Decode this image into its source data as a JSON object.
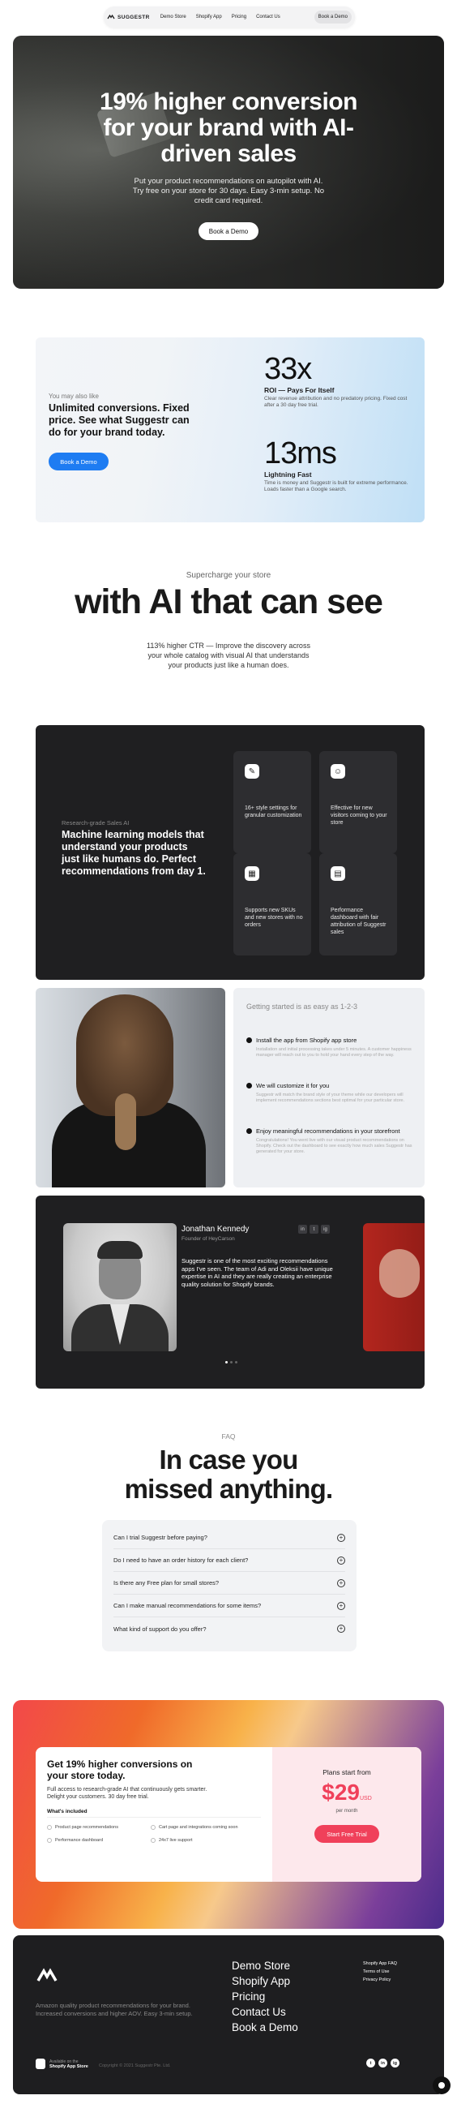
{
  "nav": {
    "logo_text": "SUGGESTR",
    "items": [
      "Demo Store",
      "Shopify App",
      "Pricing",
      "Contact Us"
    ],
    "demo_label": "Book a Demo"
  },
  "hero": {
    "title": "19% higher conversion for your brand with AI-driven sales",
    "subtitle": "Put your product recommendations on autopilot with AI. Try free on your store for 30 days. Easy 3-min setup. No credit card required.",
    "cta": "Book a Demo"
  },
  "promo": {
    "kicker": "You may also like",
    "title": "Unlimited conversions. Fixed price. See what Suggestr can do for your brand today.",
    "cta": "Book a Demo",
    "stats": [
      {
        "value": "33x",
        "title": "ROI — Pays For Itself",
        "desc": "Clear revenue attribution and no predatory pricing. Fixed cost after a 30 day free trial."
      },
      {
        "value": "13ms",
        "title": "Lightning Fast",
        "desc": "Time is money and Suggestr is built for extreme performance. Loads faster than a Google search."
      }
    ]
  },
  "supercharge": {
    "kicker": "Supercharge your store",
    "title": "with AI that can see",
    "desc": "113% higher CTR — Improve the discovery across your whole catalog with visual AI that understands your products just like a human does."
  },
  "ml": {
    "kicker": "Research-grade Sales AI",
    "title": "Machine learning models that understand your products just like humans do. Perfect recommendations from day 1.",
    "tiles": [
      {
        "icon": "pencil-icon",
        "glyph": "✎",
        "text": "16+ style settings for granular customization"
      },
      {
        "icon": "users-icon",
        "glyph": "☺",
        "text": "Effective for new visitors coming to your store"
      },
      {
        "icon": "grid-icon",
        "glyph": "▦",
        "text": "Supports new SKUs and new stores with no orders"
      },
      {
        "icon": "chart-icon",
        "glyph": "▤",
        "text": "Performance dashboard with fair attribution of Suggestr sales"
      }
    ]
  },
  "getting_started": {
    "title": "Getting started is as easy as 1-2-3",
    "steps": [
      {
        "title": "Install the app from Shopify app store",
        "desc": "Installation and initial processing takes under 5 minutes. A customer happiness manager will reach out to you to hold your hand every step of the way."
      },
      {
        "title": "We will customize it for you",
        "desc": "Suggestr will match the brand style of your theme while our developers will implement recommendations sections best optimal for your particular store."
      },
      {
        "title": "Enjoy meaningful recommendations in your storefront",
        "desc": "Congratulations! You went live with our visual product recommendations on Shopify. Check out the dashboard to see exactly how much sales Suggestr has generated for your store."
      }
    ]
  },
  "testimonial": {
    "name": "Jonathan Kennedy",
    "role": "Founder of HeyCarson",
    "quote": "Suggestr is one of the most exciting recommendations apps I've seen. The team of Adi and Oleksii have unique expertise in AI and they are really creating an enterprise quality solution for Shopify brands.",
    "socials": [
      "in",
      "t",
      "ig"
    ]
  },
  "faq": {
    "kicker": "FAQ",
    "title": "In case you missed anything.",
    "questions": [
      "Can I trial Suggestr before paying?",
      "Do I need to have an order history for each client?",
      "Is there any Free plan for small stores?",
      "Can I make manual recommendations for some items?",
      "What kind of support do you offer?"
    ]
  },
  "pricing": {
    "title": "Get 19% higher conversions on your store today.",
    "subtitle": "Full access to research-grade AI that continuously gets smarter. Delight your customers. 30 day free trial.",
    "included_label": "What's included",
    "features": [
      "Product page recommendations",
      "Cart page and integrations coming soon",
      "Performance dashboard",
      "24x7 live support"
    ],
    "plans_label": "Plans start from",
    "price": "$29",
    "currency": "USD",
    "per": "per month",
    "cta": "Start Free Trial"
  },
  "footer": {
    "desc": "Amazon quality product recommendations for your brand. Increased conversions and higher AOV. Easy 3-min setup.",
    "links": [
      "Demo Store",
      "Shopify App",
      "Pricing",
      "Contact Us",
      "Book a Demo"
    ],
    "legal": [
      "Shopify App FAQ",
      "Terms of Use",
      "Privacy Policy"
    ],
    "badge_top": "Available on the",
    "badge_bottom": "Shopify App Store",
    "copyright": "Copyright © 2021 Suggestr Pte. Ltd.",
    "socials": [
      "t",
      "in",
      "ig"
    ]
  },
  "colors": {
    "accent_blue": "#1e7cf2",
    "accent_pink": "#f0405a",
    "dark": "#1f1f21"
  }
}
